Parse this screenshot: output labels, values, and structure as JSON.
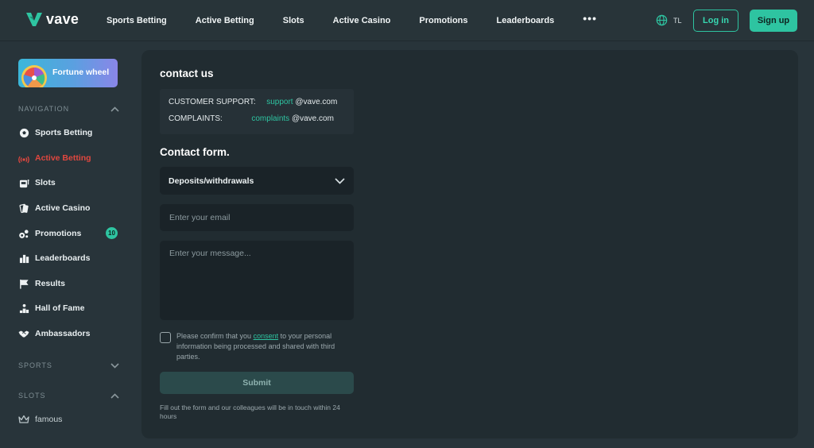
{
  "brand": {
    "name": "vave",
    "accent": "#2ec4a1",
    "active_color": "#e0473f"
  },
  "header": {
    "nav": [
      "Sports Betting",
      "Active Betting",
      "Slots",
      "Active Casino",
      "Promotions",
      "Leaderboards"
    ],
    "more": "•••",
    "lang": "TL",
    "login": "Log in",
    "signup": "Sign up"
  },
  "sidebar": {
    "fortune_wheel": "Fortune wheel",
    "navigation_title": "NAVIGATION",
    "items": [
      {
        "label": "Sports Betting",
        "icon": "soccer-ball-icon"
      },
      {
        "label": "Active Betting",
        "icon": "live-signal-icon",
        "active": true
      },
      {
        "label": "Slots",
        "icon": "slot-machine-icon"
      },
      {
        "label": "Active Casino",
        "icon": "cards-icon"
      },
      {
        "label": "Promotions",
        "icon": "gift-icon",
        "badge": "10"
      },
      {
        "label": "Leaderboards",
        "icon": "trophy-icon"
      },
      {
        "label": "Results",
        "icon": "flag-icon"
      },
      {
        "label": "Hall of Fame",
        "icon": "podium-icon"
      },
      {
        "label": "Ambassadors",
        "icon": "handshake-icon"
      }
    ],
    "sports_title": "SPORTS",
    "slots_title": "SLOTS",
    "slots_items": [
      {
        "label": "famous",
        "icon": "crown-icon"
      }
    ]
  },
  "main": {
    "title": "contact us",
    "support_label": "CUSTOMER SUPPORT:",
    "support_user": "support",
    "support_domain": "@vave.com",
    "complaints_label": "COMPLAINTS:",
    "complaints_user": "complaints",
    "complaints_domain": "@vave.com",
    "form_title": "Contact form.",
    "topic": "Deposits/withdrawals",
    "email_placeholder": "Enter your email",
    "message_placeholder": "Enter your message...",
    "consent_before": "Please confirm that you ",
    "consent_link": "consent",
    "consent_after": " to your personal information being processed and shared with third parties.",
    "submit": "Submit",
    "footnote": "Fill out the form and our colleagues will be in touch within 24 hours"
  }
}
